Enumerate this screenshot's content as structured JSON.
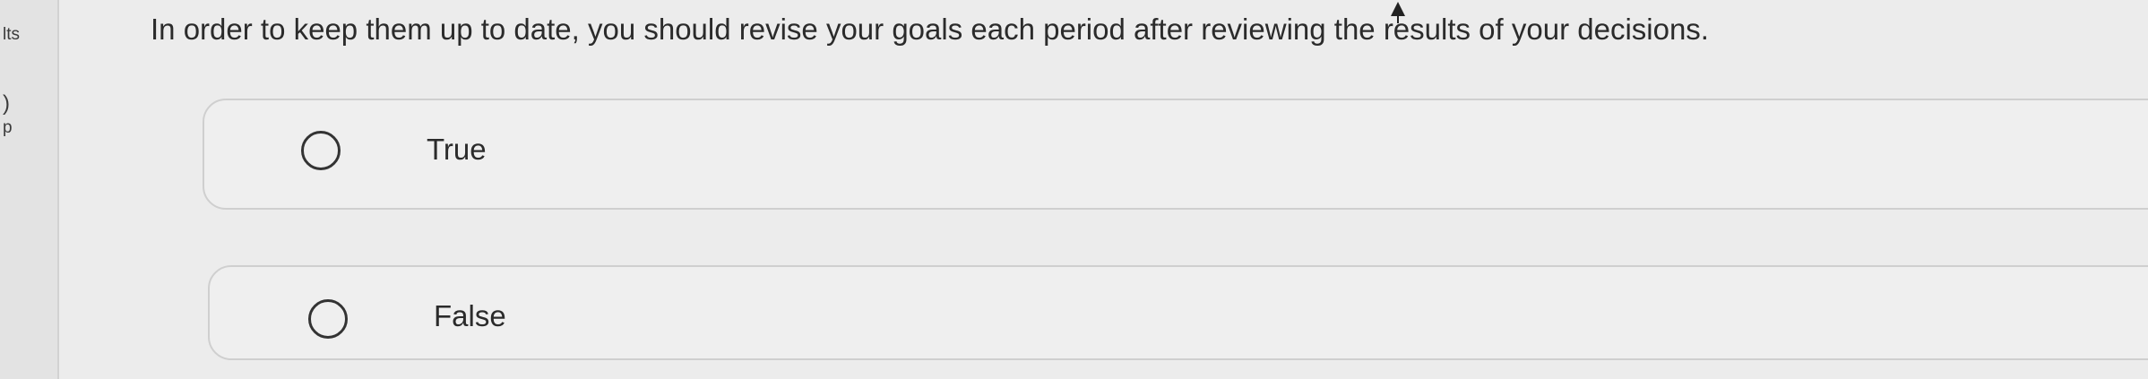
{
  "sidebar": {
    "fragments": [
      "lts",
      ")",
      "p"
    ]
  },
  "question": {
    "text": "In order to keep them up to date, you should revise your goals each period after reviewing the results of your decisions."
  },
  "options": [
    {
      "label": "True",
      "selected": false
    },
    {
      "label": "False",
      "selected": false
    }
  ]
}
